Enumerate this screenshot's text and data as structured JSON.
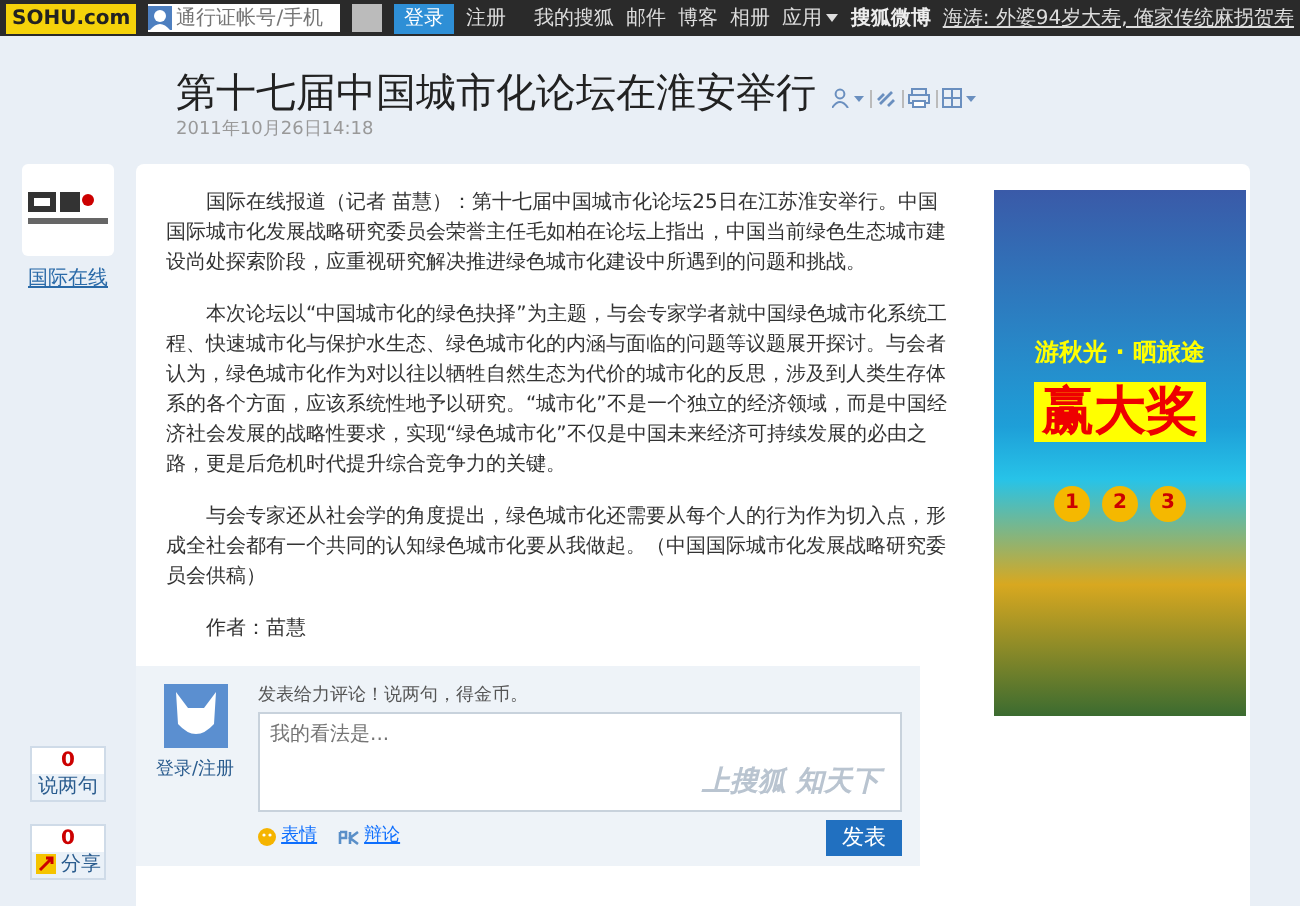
{
  "topbar": {
    "logo": "SOHU.com",
    "account_placeholder": "通行证帐号/手机",
    "login_button": "登录",
    "register_link": "注册",
    "nav": [
      {
        "label": "我的搜狐",
        "dropdown": false
      },
      {
        "label": "邮件",
        "dropdown": false
      },
      {
        "label": "博客",
        "dropdown": false
      },
      {
        "label": "相册",
        "dropdown": false
      },
      {
        "label": "应用",
        "dropdown": true
      }
    ],
    "weibo_label": "搜狐微博",
    "weibo_link": "海涛: 外婆94岁大寿, 俺家传统麻拐贺寿"
  },
  "article": {
    "title": "第十七届中国城市化论坛在淮安举行",
    "date": "2011年10月26日14:18",
    "source": {
      "name": "国际在线"
    },
    "paragraphs": [
      "国际在线报道（记者 苗慧）：第十七届中国城市化论坛25日在江苏淮安举行。中国国际城市化发展战略研究委员会荣誉主任毛如柏在论坛上指出，中国当前绿色生态城市建设尚处探索阶段，应重视研究解决推进绿色城市化建设中所遇到的问题和挑战。",
      "本次论坛以“中国城市化的绿色抉择”为主题，与会专家学者就中国绿色城市化系统工程、快速城市化与保护水生态、绿色城市化的内涵与面临的问题等议题展开探讨。与会者认为，绿色城市化作为对以往以牺牲自然生态为代价的城市化的反思，涉及到人类生存体系的各个方面，应该系统性地予以研究。“城市化”不是一个独立的经济领域，而是中国经济社会发展的战略性要求，实现“绿色城市化”不仅是中国未来经济可持续发展的必由之路，更是后危机时代提升综合竞争力的关键。",
      "与会专家还从社会学的角度提出，绿色城市化还需要从每个人的行为作为切入点，形成全社会都有一个共同的认知绿色城市化要从我做起。（中国国际城市化发展战略研究委员会供稿）",
      "作者：苗慧"
    ]
  },
  "counters": [
    {
      "count": "0",
      "label": "说两句",
      "kind": "comment"
    },
    {
      "count": "0",
      "label": "分享",
      "kind": "share"
    }
  ],
  "ad": {
    "slogan": "游秋光 · 晒旅途",
    "headline": "赢大奖",
    "prizes": [
      "1",
      "2",
      "3"
    ]
  },
  "comment": {
    "prompt": "发表给力评论！说两句，得金币。",
    "login_link": "登录",
    "separator": "/",
    "register_link": "注册",
    "placeholder": "我的看法是...",
    "slogan": "上搜狐 知天下",
    "emoji_label": "表情",
    "pk_label": "辩论",
    "submit": "发表"
  }
}
